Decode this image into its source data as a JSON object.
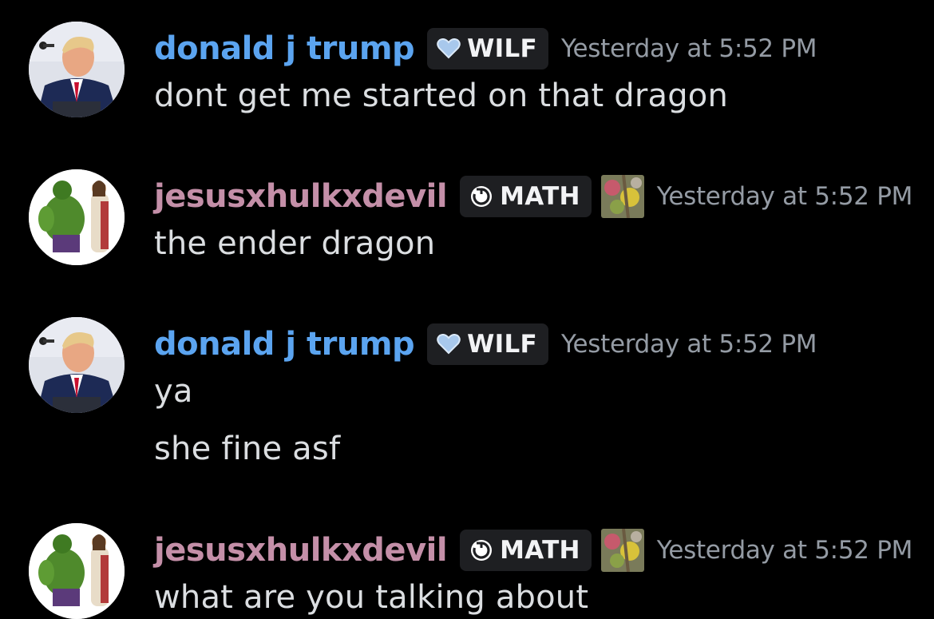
{
  "colors": {
    "background": "#000000",
    "trump_username": "#5ba4f0",
    "jesus_username": "#c48fa8",
    "timestamp": "#949ba4",
    "message_text": "#dbdee1",
    "tag_background": "#1e1f22"
  },
  "messages": [
    {
      "avatar_icon": "trump-avatar",
      "username": "donald j trump",
      "tag": {
        "icon": "heart-icon",
        "label": "WILF"
      },
      "timestamp": "Yesterday at 5:52 PM",
      "lines": [
        "dont get me started on that dragon"
      ]
    },
    {
      "avatar_icon": "hulk-jesus-avatar",
      "username": "jesusxhulkxdevil",
      "tag": {
        "icon": "reload-icon",
        "label": "MATH"
      },
      "decoration_icon": "flower-icon",
      "timestamp": "Yesterday at 5:52 PM",
      "lines": [
        "the ender dragon"
      ]
    },
    {
      "avatar_icon": "trump-avatar",
      "username": "donald j trump",
      "tag": {
        "icon": "heart-icon",
        "label": "WILF"
      },
      "timestamp": "Yesterday at 5:52 PM",
      "lines": [
        "ya",
        "she fine asf"
      ]
    },
    {
      "avatar_icon": "hulk-jesus-avatar",
      "username": "jesusxhulkxdevil",
      "tag": {
        "icon": "reload-icon",
        "label": "MATH"
      },
      "decoration_icon": "flower-icon",
      "timestamp": "Yesterday at 5:52 PM",
      "lines": [
        "what are you talking about"
      ]
    }
  ]
}
